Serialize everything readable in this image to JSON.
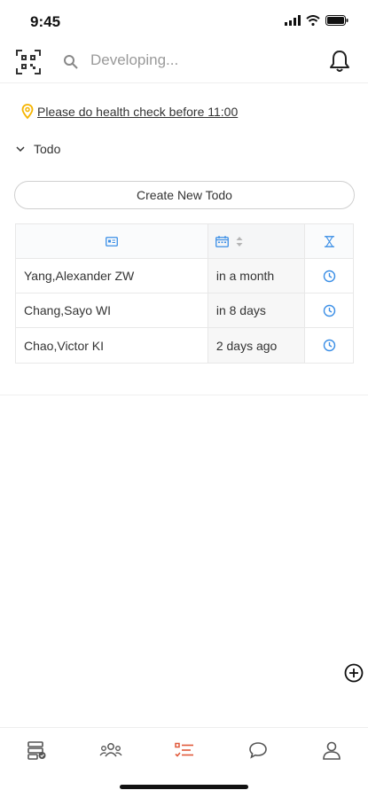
{
  "status": {
    "time": "9:45"
  },
  "header": {
    "search_placeholder": "Developing..."
  },
  "notice": {
    "text": "Please do health check before 11:00"
  },
  "section": {
    "label": "Todo"
  },
  "create_button": {
    "label": "Create New Todo"
  },
  "todo_rows": [
    {
      "name": "Yang,Alexander ZW",
      "due": "in a month"
    },
    {
      "name": "Chang,Sayo WI",
      "due": "in 8 days"
    },
    {
      "name": "Chao,Victor KI",
      "due": "2 days ago"
    }
  ],
  "icons": {
    "qr": "qr-code-scan-icon",
    "search": "search-icon",
    "bell": "bell-icon",
    "notice": "location-pin-icon",
    "collapse": "chevron-down-icon",
    "col_name": "id-card-icon",
    "col_date": "calendar-icon",
    "col_sort": "sort-icon",
    "col_timer": "hourglass-icon",
    "row_clock": "clock-icon",
    "fab": "add-circle-icon",
    "tabs": [
      "dashboard-icon",
      "team-icon",
      "task-list-icon",
      "chat-icon",
      "profile-icon"
    ]
  },
  "colors": {
    "accent_blue": "#3a8ee6",
    "accent_orange": "#e0593a",
    "pin_yellow": "#f5b400"
  },
  "tabs": {
    "active_index": 2
  }
}
